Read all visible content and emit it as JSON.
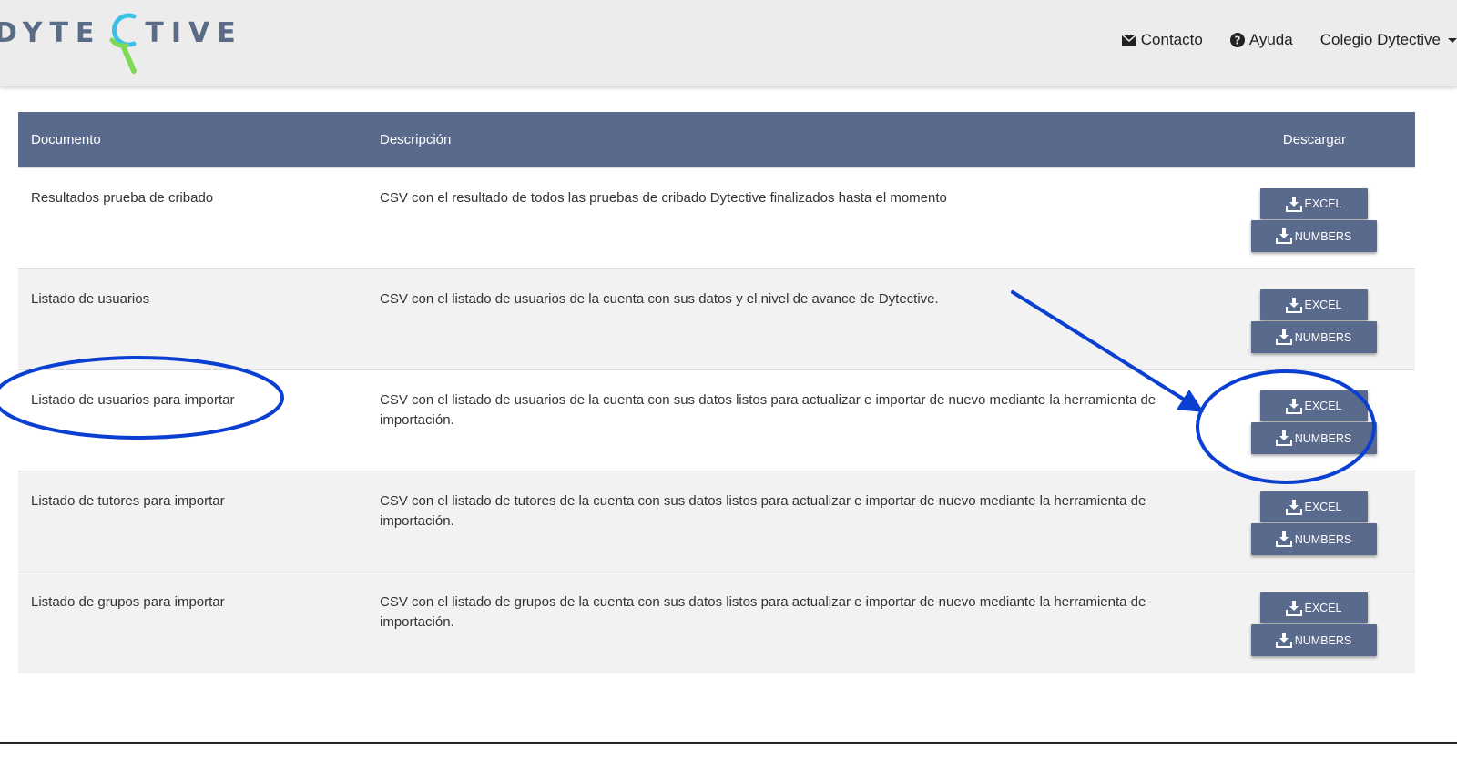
{
  "brand": {
    "logo_left": "DYTE",
    "logo_right": "TIVE",
    "colors": {
      "primary": "#5a6b85",
      "accent_green": "#7ed957",
      "accent_blue": "#3cc0e8"
    }
  },
  "navbar": {
    "contact_label": "Contacto",
    "help_label": "Ayuda",
    "account_label": "Colegio Dytective"
  },
  "table": {
    "headers": {
      "document": "Documento",
      "description": "Descripción",
      "download": "Descargar"
    },
    "rows": [
      {
        "document": "Resultados prueba de cribado",
        "description": "CSV con el resultado de todos las pruebas de cribado Dytective finalizados hasta el momento",
        "excel_label": "EXCEL",
        "numbers_label": "NUMBERS"
      },
      {
        "document": "Listado de usuarios",
        "description": "CSV con el listado de usuarios de la cuenta con sus datos y el nivel de avance de Dytective.",
        "excel_label": "EXCEL",
        "numbers_label": "NUMBERS"
      },
      {
        "document": "Listado de usuarios para importar",
        "description": "CSV con el listado de usuarios de la cuenta con sus datos listos para actualizar e importar de nuevo mediante la herramienta de importación.",
        "excel_label": "EXCEL",
        "numbers_label": "NUMBERS"
      },
      {
        "document": "Listado de tutores para importar",
        "description": "CSV con el listado de tutores de la cuenta con sus datos listos para actualizar e importar de nuevo mediante la herramienta de importación.",
        "excel_label": "EXCEL",
        "numbers_label": "NUMBERS"
      },
      {
        "document": "Listado de grupos para importar",
        "description": "CSV con el listado de grupos de la cuenta con sus datos listos para actualizar e importar de nuevo mediante la herramienta de importación.",
        "excel_label": "EXCEL",
        "numbers_label": "NUMBERS"
      }
    ]
  },
  "annotations": {
    "color": "#0a3fd1",
    "highlighted_row": "Listado de usuarios para importar"
  },
  "icons": [
    "envelope-icon",
    "question-circle-icon",
    "caret-down-icon",
    "download-icon"
  ]
}
